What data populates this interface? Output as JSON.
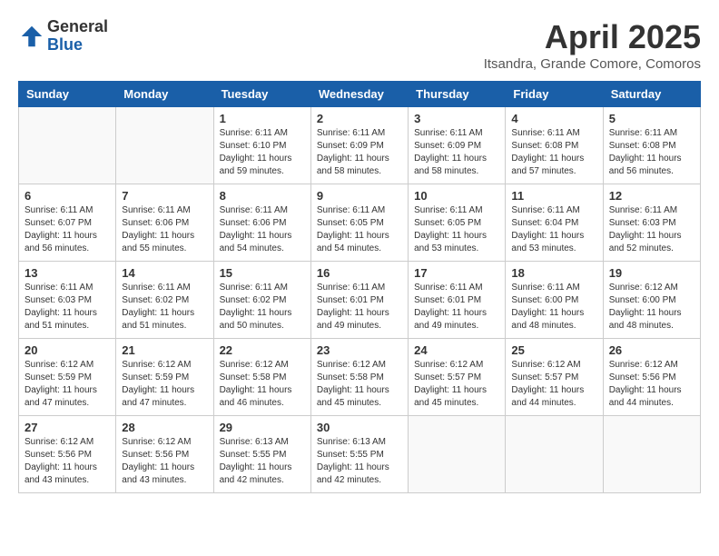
{
  "logo": {
    "general": "General",
    "blue": "Blue"
  },
  "title": "April 2025",
  "location": "Itsandra, Grande Comore, Comoros",
  "days_of_week": [
    "Sunday",
    "Monday",
    "Tuesday",
    "Wednesday",
    "Thursday",
    "Friday",
    "Saturday"
  ],
  "weeks": [
    [
      {
        "day": "",
        "sunrise": "",
        "sunset": "",
        "daylight": ""
      },
      {
        "day": "",
        "sunrise": "",
        "sunset": "",
        "daylight": ""
      },
      {
        "day": "1",
        "sunrise": "Sunrise: 6:11 AM",
        "sunset": "Sunset: 6:10 PM",
        "daylight": "Daylight: 11 hours and 59 minutes."
      },
      {
        "day": "2",
        "sunrise": "Sunrise: 6:11 AM",
        "sunset": "Sunset: 6:09 PM",
        "daylight": "Daylight: 11 hours and 58 minutes."
      },
      {
        "day": "3",
        "sunrise": "Sunrise: 6:11 AM",
        "sunset": "Sunset: 6:09 PM",
        "daylight": "Daylight: 11 hours and 58 minutes."
      },
      {
        "day": "4",
        "sunrise": "Sunrise: 6:11 AM",
        "sunset": "Sunset: 6:08 PM",
        "daylight": "Daylight: 11 hours and 57 minutes."
      },
      {
        "day": "5",
        "sunrise": "Sunrise: 6:11 AM",
        "sunset": "Sunset: 6:08 PM",
        "daylight": "Daylight: 11 hours and 56 minutes."
      }
    ],
    [
      {
        "day": "6",
        "sunrise": "Sunrise: 6:11 AM",
        "sunset": "Sunset: 6:07 PM",
        "daylight": "Daylight: 11 hours and 56 minutes."
      },
      {
        "day": "7",
        "sunrise": "Sunrise: 6:11 AM",
        "sunset": "Sunset: 6:06 PM",
        "daylight": "Daylight: 11 hours and 55 minutes."
      },
      {
        "day": "8",
        "sunrise": "Sunrise: 6:11 AM",
        "sunset": "Sunset: 6:06 PM",
        "daylight": "Daylight: 11 hours and 54 minutes."
      },
      {
        "day": "9",
        "sunrise": "Sunrise: 6:11 AM",
        "sunset": "Sunset: 6:05 PM",
        "daylight": "Daylight: 11 hours and 54 minutes."
      },
      {
        "day": "10",
        "sunrise": "Sunrise: 6:11 AM",
        "sunset": "Sunset: 6:05 PM",
        "daylight": "Daylight: 11 hours and 53 minutes."
      },
      {
        "day": "11",
        "sunrise": "Sunrise: 6:11 AM",
        "sunset": "Sunset: 6:04 PM",
        "daylight": "Daylight: 11 hours and 53 minutes."
      },
      {
        "day": "12",
        "sunrise": "Sunrise: 6:11 AM",
        "sunset": "Sunset: 6:03 PM",
        "daylight": "Daylight: 11 hours and 52 minutes."
      }
    ],
    [
      {
        "day": "13",
        "sunrise": "Sunrise: 6:11 AM",
        "sunset": "Sunset: 6:03 PM",
        "daylight": "Daylight: 11 hours and 51 minutes."
      },
      {
        "day": "14",
        "sunrise": "Sunrise: 6:11 AM",
        "sunset": "Sunset: 6:02 PM",
        "daylight": "Daylight: 11 hours and 51 minutes."
      },
      {
        "day": "15",
        "sunrise": "Sunrise: 6:11 AM",
        "sunset": "Sunset: 6:02 PM",
        "daylight": "Daylight: 11 hours and 50 minutes."
      },
      {
        "day": "16",
        "sunrise": "Sunrise: 6:11 AM",
        "sunset": "Sunset: 6:01 PM",
        "daylight": "Daylight: 11 hours and 49 minutes."
      },
      {
        "day": "17",
        "sunrise": "Sunrise: 6:11 AM",
        "sunset": "Sunset: 6:01 PM",
        "daylight": "Daylight: 11 hours and 49 minutes."
      },
      {
        "day": "18",
        "sunrise": "Sunrise: 6:11 AM",
        "sunset": "Sunset: 6:00 PM",
        "daylight": "Daylight: 11 hours and 48 minutes."
      },
      {
        "day": "19",
        "sunrise": "Sunrise: 6:12 AM",
        "sunset": "Sunset: 6:00 PM",
        "daylight": "Daylight: 11 hours and 48 minutes."
      }
    ],
    [
      {
        "day": "20",
        "sunrise": "Sunrise: 6:12 AM",
        "sunset": "Sunset: 5:59 PM",
        "daylight": "Daylight: 11 hours and 47 minutes."
      },
      {
        "day": "21",
        "sunrise": "Sunrise: 6:12 AM",
        "sunset": "Sunset: 5:59 PM",
        "daylight": "Daylight: 11 hours and 47 minutes."
      },
      {
        "day": "22",
        "sunrise": "Sunrise: 6:12 AM",
        "sunset": "Sunset: 5:58 PM",
        "daylight": "Daylight: 11 hours and 46 minutes."
      },
      {
        "day": "23",
        "sunrise": "Sunrise: 6:12 AM",
        "sunset": "Sunset: 5:58 PM",
        "daylight": "Daylight: 11 hours and 45 minutes."
      },
      {
        "day": "24",
        "sunrise": "Sunrise: 6:12 AM",
        "sunset": "Sunset: 5:57 PM",
        "daylight": "Daylight: 11 hours and 45 minutes."
      },
      {
        "day": "25",
        "sunrise": "Sunrise: 6:12 AM",
        "sunset": "Sunset: 5:57 PM",
        "daylight": "Daylight: 11 hours and 44 minutes."
      },
      {
        "day": "26",
        "sunrise": "Sunrise: 6:12 AM",
        "sunset": "Sunset: 5:56 PM",
        "daylight": "Daylight: 11 hours and 44 minutes."
      }
    ],
    [
      {
        "day": "27",
        "sunrise": "Sunrise: 6:12 AM",
        "sunset": "Sunset: 5:56 PM",
        "daylight": "Daylight: 11 hours and 43 minutes."
      },
      {
        "day": "28",
        "sunrise": "Sunrise: 6:12 AM",
        "sunset": "Sunset: 5:56 PM",
        "daylight": "Daylight: 11 hours and 43 minutes."
      },
      {
        "day": "29",
        "sunrise": "Sunrise: 6:13 AM",
        "sunset": "Sunset: 5:55 PM",
        "daylight": "Daylight: 11 hours and 42 minutes."
      },
      {
        "day": "30",
        "sunrise": "Sunrise: 6:13 AM",
        "sunset": "Sunset: 5:55 PM",
        "daylight": "Daylight: 11 hours and 42 minutes."
      },
      {
        "day": "",
        "sunrise": "",
        "sunset": "",
        "daylight": ""
      },
      {
        "day": "",
        "sunrise": "",
        "sunset": "",
        "daylight": ""
      },
      {
        "day": "",
        "sunrise": "",
        "sunset": "",
        "daylight": ""
      }
    ]
  ]
}
